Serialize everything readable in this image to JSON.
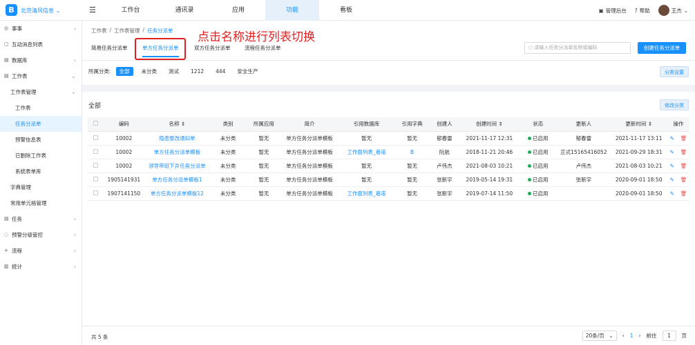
{
  "topbar": {
    "org": "北京清风信息",
    "menu_toggle_icon": "menu-fold-icon",
    "nav": [
      "工作台",
      "通讯录",
      "应用",
      "功能",
      "看板"
    ],
    "active_nav": "功能",
    "admin": "管理后台",
    "help": "帮助",
    "user": "王杰"
  },
  "sidebar": {
    "items": [
      {
        "label": "事事",
        "level": 1,
        "icon": "◎",
        "chev": "‹"
      },
      {
        "label": "互动消息列表",
        "level": 1,
        "icon": "▢",
        "chev": ""
      },
      {
        "label": "数据库",
        "level": 1,
        "icon": "▤",
        "chev": "‹"
      },
      {
        "label": "工作表",
        "level": 1,
        "icon": "▤",
        "chev": "⌄"
      },
      {
        "label": "工作表管理",
        "level": 2,
        "icon": "",
        "chev": "⌄"
      },
      {
        "label": "工作表",
        "level": 3,
        "icon": "",
        "chev": ""
      },
      {
        "label": "任务分派单",
        "level": 3,
        "icon": "",
        "chev": "",
        "active": true
      },
      {
        "label": "预警信息表",
        "level": 3,
        "icon": "",
        "chev": ""
      },
      {
        "label": "已删除工作表",
        "level": 3,
        "icon": "",
        "chev": ""
      },
      {
        "label": "系统表单库",
        "level": 3,
        "icon": "",
        "chev": ""
      },
      {
        "label": "字典管理",
        "level": 2,
        "icon": "",
        "chev": ""
      },
      {
        "label": "常用单元格管理",
        "level": 2,
        "icon": "",
        "chev": ""
      },
      {
        "label": "任务",
        "level": 1,
        "icon": "▤",
        "chev": "‹"
      },
      {
        "label": "预警分级管控",
        "level": 1,
        "icon": "◌",
        "chev": "‹"
      },
      {
        "label": "流程",
        "level": 1,
        "icon": "+",
        "chev": "‹"
      },
      {
        "label": "统计",
        "level": 1,
        "icon": "▥",
        "chev": "‹"
      }
    ]
  },
  "breadcrumb": [
    "工作表",
    "/",
    "工作表管理",
    "/",
    "任务分派单"
  ],
  "annotation": "点击名称进行列表切换",
  "tabs": [
    "简易任务分派单",
    "单方任务分派单",
    "双方任务分派单",
    "流程任务分派单"
  ],
  "active_tab": "单方任务分派单",
  "search_placeholder": "请输入任务分派单名称或编码",
  "create_button": "创建任务分派单",
  "filter": {
    "label": "所属分类:",
    "chips": [
      "全部",
      "未分类",
      "测试",
      "1212",
      "444",
      "安全生产"
    ],
    "active": "全部",
    "settings_button": "分类设置"
  },
  "section_title": "全部",
  "edit_category_button": "修改分类",
  "table": {
    "headers": [
      "",
      "编码",
      "名称 ⇕",
      "类别",
      "所属应用",
      "简介",
      "引用数据库",
      "引用字典",
      "创建人",
      "创建时间 ⇕",
      "状态",
      "更新人",
      "更新时间 ⇕",
      "操作"
    ],
    "rows": [
      {
        "code": "10002",
        "name": "隐患整改通知单",
        "category": "未分类",
        "app": "暂无",
        "intro": "单方任务分派单模板",
        "db": "暂无",
        "dict": "暂无",
        "creator": "郁春雷",
        "created": "2021-11-17 12:31",
        "status": "已启用",
        "updater": "郁春雷",
        "updated": "2021-11-17 13:11"
      },
      {
        "code": "10002",
        "name": "单方任务分派单模板",
        "category": "未分类",
        "app": "暂无",
        "intro": "单方任务分派单模板",
        "db": "工作面列表_巷道",
        "dict": "B",
        "creator": "阮航",
        "created": "2018-11-21 20:46",
        "status": "已启用",
        "updater": "正式15165416052",
        "updated": "2021-09-29 18:31"
      },
      {
        "code": "10002",
        "name": "领导带班下井任务分派单",
        "category": "未分类",
        "app": "暂无",
        "intro": "单方任务分派单模板",
        "db": "暂无",
        "dict": "暂无",
        "creator": "卢伟杰",
        "created": "2021-08-03 10:21",
        "status": "已启用",
        "updater": "卢伟杰",
        "updated": "2021-08-03 10:21"
      },
      {
        "code": "1905141931",
        "name": "单方任务分派单模板1",
        "category": "未分类",
        "app": "暂无",
        "intro": "单方任务分派单模板",
        "db": "暂无",
        "dict": "暂无",
        "creator": "张新宇",
        "created": "2019-05-14 19:31",
        "status": "已启用",
        "updater": "张新宇",
        "updated": "2020-09-01 18:50"
      },
      {
        "code": "1907141150",
        "name": "单方任务分派单模板12",
        "category": "未分类",
        "app": "暂无",
        "intro": "单方任务分派单模板",
        "db": "工作面列表_巷道",
        "dict": "暂无",
        "creator": "张新宇",
        "created": "2019-07-14 11:50",
        "status": "已启用",
        "updater": "",
        "updated": "2020-09-01 18:50"
      }
    ]
  },
  "footer": {
    "total": "共 5 条",
    "page_size": "20条/页",
    "prev": "‹",
    "page": "1",
    "next": "›",
    "goto_label": "前往",
    "goto_value": "1",
    "page_suffix": "页"
  }
}
